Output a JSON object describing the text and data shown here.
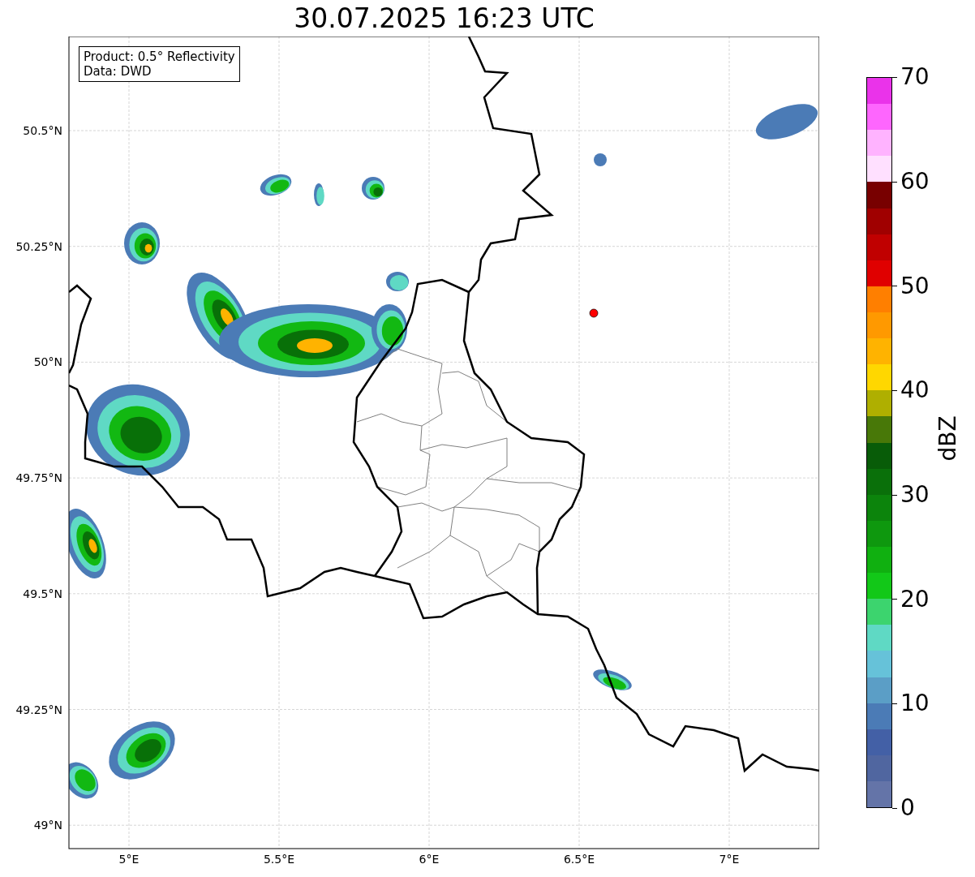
{
  "title": "30.07.2025 16:23 UTC",
  "info_box": [
    "Product: 0.5° Reflectivity",
    "Data: DWD"
  ],
  "map": {
    "lat_labels": [
      "50.5°N",
      "50.25°N",
      "50°N",
      "49.75°N",
      "49.5°N",
      "49.25°N",
      "49°N"
    ],
    "lon_labels": [
      "5°E",
      "5.5°E",
      "6°E",
      "6.5°E",
      "7°E"
    ]
  },
  "colorbar": {
    "label": "dBZ",
    "ticks": [
      "70",
      "60",
      "50",
      "40",
      "30",
      "20",
      "10",
      "0"
    ],
    "bins": [
      {
        "color": "#ea33ea"
      },
      {
        "color": "#fe66fe"
      },
      {
        "color": "#ffb3ff"
      },
      {
        "color": "#ffe0ff"
      },
      {
        "color": "#780000"
      },
      {
        "color": "#a00000"
      },
      {
        "color": "#c00000"
      },
      {
        "color": "#e00000"
      },
      {
        "color": "#ff7f00"
      },
      {
        "color": "#ff9900"
      },
      {
        "color": "#ffb300"
      },
      {
        "color": "#ffd700"
      },
      {
        "color": "#afaf00"
      },
      {
        "color": "#487808"
      },
      {
        "color": "#085c08"
      },
      {
        "color": "#0a700a"
      },
      {
        "color": "#0c840c"
      },
      {
        "color": "#0e980e"
      },
      {
        "color": "#10b010"
      },
      {
        "color": "#12c818"
      },
      {
        "color": "#3cd46e"
      },
      {
        "color": "#5fd9c4"
      },
      {
        "color": "#66c2d9"
      },
      {
        "color": "#5b9ec6"
      },
      {
        "color": "#4b7bb6"
      },
      {
        "color": "#4360a6"
      },
      {
        "color": "#5066a0"
      },
      {
        "color": "#6474a8"
      }
    ]
  }
}
